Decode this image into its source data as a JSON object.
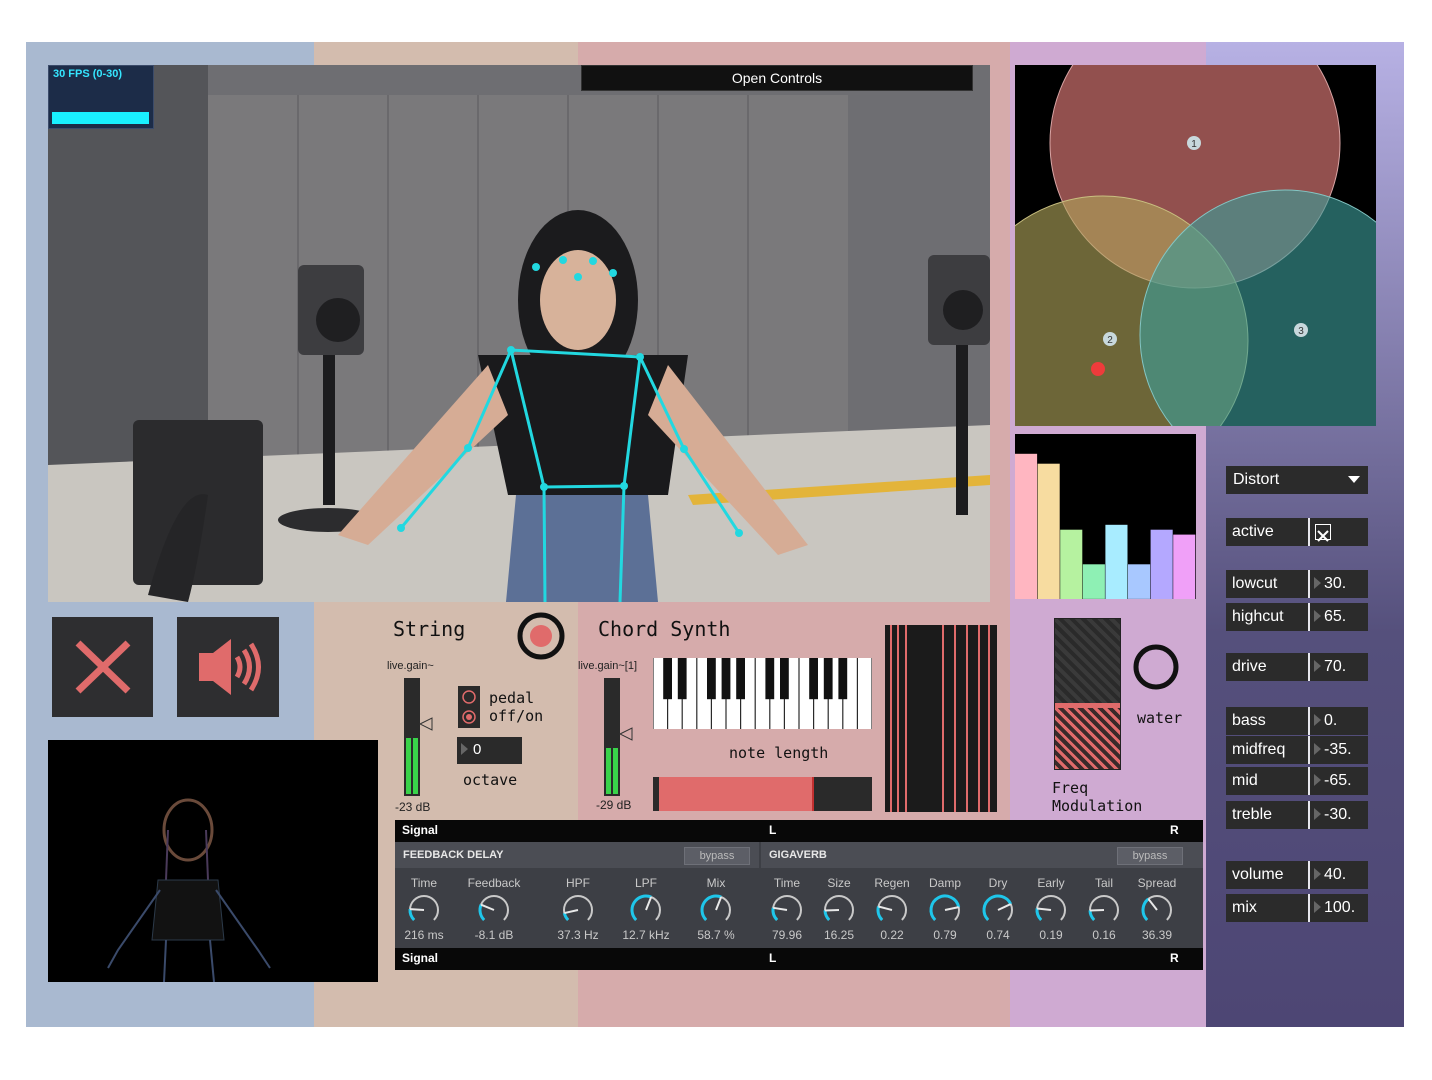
{
  "fps": {
    "label": "30 FPS (0-30)",
    "level": 1.0
  },
  "open_controls": "Open Controls",
  "venn": {
    "labels": [
      "1",
      "2",
      "3"
    ]
  },
  "histogram": {
    "colors": [
      "#ffb6c1",
      "#f7dca0",
      "#b6f2a0",
      "#8ef0b4",
      "#a8ecff",
      "#a8c8ff",
      "#b4a8ff",
      "#f0a0f8"
    ],
    "values": [
      0.88,
      0.82,
      0.42,
      0.21,
      0.45,
      0.21,
      0.42,
      0.39
    ]
  },
  "string": {
    "title": "String",
    "gain_label": "live.gain~",
    "gain_db": "-23 dB",
    "pedal_label": "pedal\noff/on",
    "octave_value": "0",
    "octave_label": "octave"
  },
  "chord": {
    "title": "Chord Synth",
    "gain_label": "live.gain~[1]",
    "gain_db": "-29 dB",
    "note_length_label": "note length"
  },
  "freq_mod": {
    "label": "Freq\nModulation",
    "water_label": "water"
  },
  "signal_bar": {
    "left": "Signal",
    "l": "L",
    "r": "R"
  },
  "feedback_delay": {
    "title": "FEEDBACK DELAY",
    "bypass": "bypass",
    "knobs": [
      {
        "label": "Time",
        "value": "216 ms"
      },
      {
        "label": "Feedback",
        "value": "-8.1 dB"
      },
      {
        "label": "HPF",
        "value": "37.3 Hz"
      },
      {
        "label": "LPF",
        "value": "12.7 kHz"
      },
      {
        "label": "Mix",
        "value": "58.7 %"
      }
    ]
  },
  "gigaverb": {
    "title": "GIGAVERB",
    "bypass": "bypass",
    "knobs": [
      {
        "label": "Time",
        "value": "79.96"
      },
      {
        "label": "Size",
        "value": "16.25"
      },
      {
        "label": "Regen",
        "value": "0.22"
      },
      {
        "label": "Damp",
        "value": "0.79"
      },
      {
        "label": "Dry",
        "value": "0.74"
      },
      {
        "label": "Early",
        "value": "0.19"
      },
      {
        "label": "Tail",
        "value": "0.16"
      },
      {
        "label": "Spread",
        "value": "36.39"
      }
    ]
  },
  "distort": {
    "menu_value": "Distort",
    "active_label": "active",
    "active_checked": true,
    "params": [
      {
        "label": "lowcut",
        "value": "30."
      },
      {
        "label": "highcut",
        "value": "65."
      },
      {
        "label": "drive",
        "value": "70."
      },
      {
        "label": "bass",
        "value": "0."
      },
      {
        "label": "midfreq",
        "value": "-35."
      },
      {
        "label": "mid",
        "value": "-65."
      },
      {
        "label": "treble",
        "value": "-30."
      },
      {
        "label": "volume",
        "value": "40."
      },
      {
        "label": "mix",
        "value": "100."
      }
    ]
  },
  "colors": {
    "record": "#e06b6b",
    "close_x": "#e06b6b",
    "speaker": "#e06b6b",
    "meter_green": "#39d34a",
    "knob_cyan": "#1fc6ea",
    "skeleton": "#22d8e0"
  }
}
